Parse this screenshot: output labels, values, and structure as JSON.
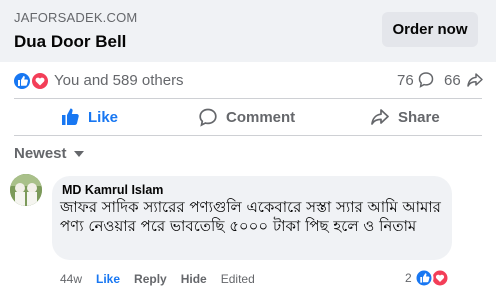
{
  "ad": {
    "domain": "JAFORSADEK.COM",
    "title": "Dua Door Bell",
    "cta_label": "Order now"
  },
  "stats": {
    "reactions_text": "You and 589 others",
    "comments_count": "76",
    "shares_count": "66"
  },
  "actions": {
    "like_label": "Like",
    "comment_label": "Comment",
    "share_label": "Share"
  },
  "comments_sort": {
    "label": "Newest"
  },
  "comment": {
    "author": "MD Kamrul Islam",
    "text": "জাফর সাদিক স্যারের পণ্যগুলি একেবারে সস্তা স্যার আমি আমার পণ্য নেওয়ার পরে ভাবতেছি ৫০০০ টাকা পিছ হলে ও নিতাম",
    "time": "44w",
    "like_label": "Like",
    "reply_label": "Reply",
    "hide_label": "Hide",
    "edited_label": "Edited",
    "reaction_count": "2"
  },
  "colors": {
    "brand_blue": "#1877f2",
    "love_red": "#f33e58",
    "muted_text": "#65676b",
    "ad_background": "#f0f2f5",
    "bubble_background": "#f0f2f5"
  },
  "icons": {
    "reactions": [
      "like-reaction-icon",
      "love-reaction-icon"
    ],
    "comment": "comment-icon",
    "share": "share-icon",
    "sort": "chevron-down-icon"
  }
}
